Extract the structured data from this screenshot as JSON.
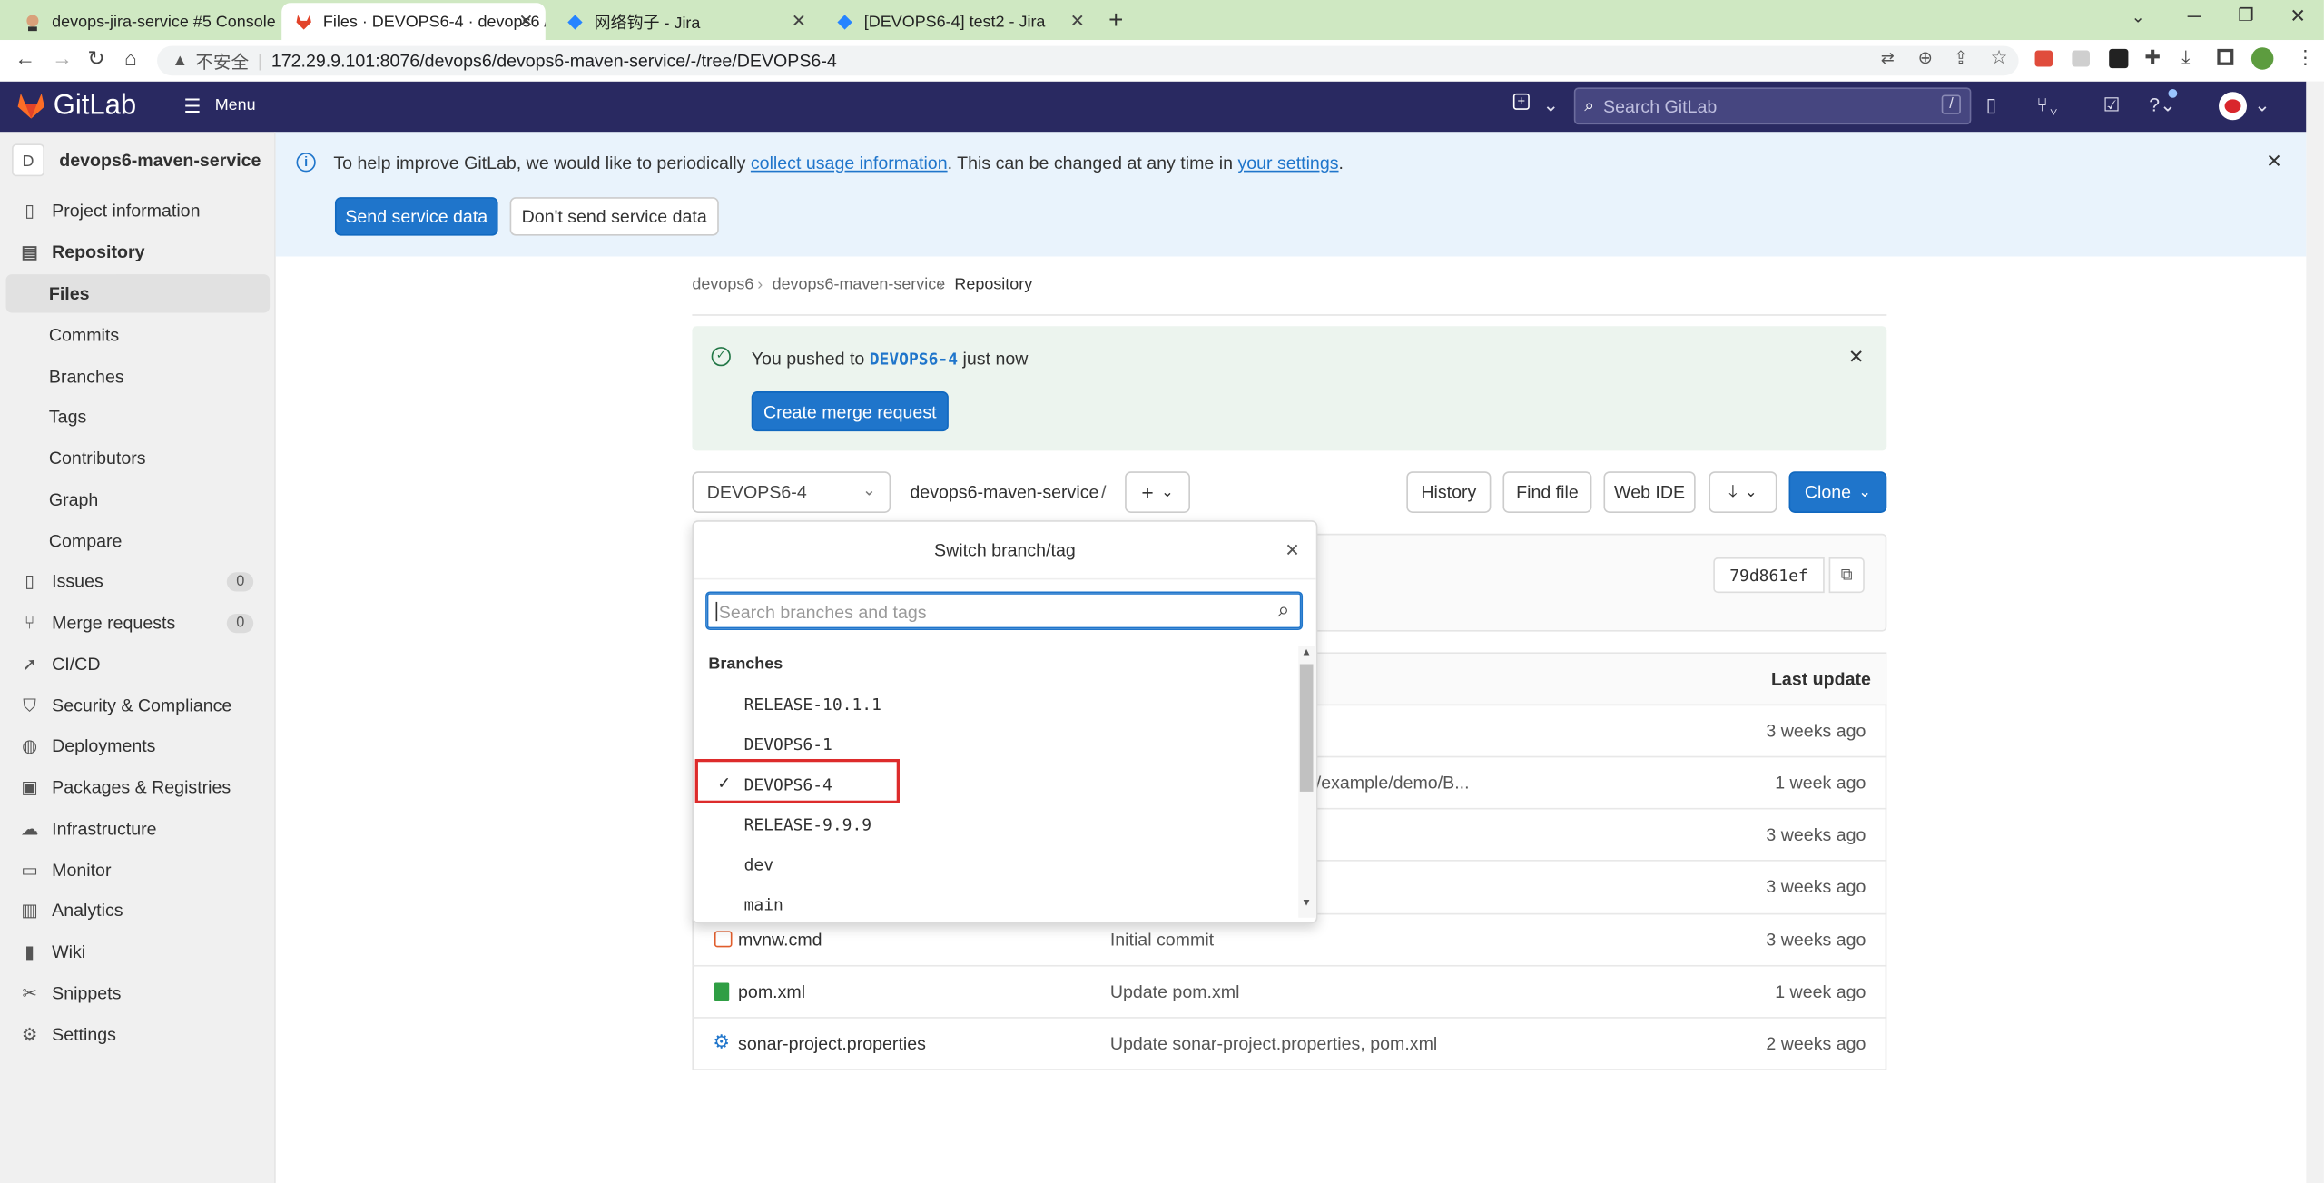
{
  "browser": {
    "tabs": [
      {
        "title": "devops-jira-service #5 Console"
      },
      {
        "title": "Files · DEVOPS6-4 · devops6 /"
      },
      {
        "title": "网络钩子 - Jira"
      },
      {
        "title": "[DEVOPS6-4] test2 - Jira"
      }
    ],
    "security_label": "不安全",
    "url": "172.29.9.101:8076/devops6/devops6-maven-service/-/tree/DEVOPS6-4"
  },
  "header": {
    "brand": "GitLab",
    "menu_label": "Menu",
    "search_placeholder": "Search GitLab",
    "search_shortcut": "/"
  },
  "sidebar": {
    "project_initial": "D",
    "project_name": "devops6-maven-service",
    "items": [
      {
        "label": "Project information",
        "icon": "info-doc-icon"
      },
      {
        "label": "Repository",
        "icon": "repository-icon"
      },
      {
        "label": "Files"
      },
      {
        "label": "Commits"
      },
      {
        "label": "Branches"
      },
      {
        "label": "Tags"
      },
      {
        "label": "Contributors"
      },
      {
        "label": "Graph"
      },
      {
        "label": "Compare"
      },
      {
        "label": "Issues",
        "count": "0"
      },
      {
        "label": "Merge requests",
        "count": "0"
      },
      {
        "label": "CI/CD"
      },
      {
        "label": "Security & Compliance"
      },
      {
        "label": "Deployments"
      },
      {
        "label": "Packages & Registries"
      },
      {
        "label": "Infrastructure"
      },
      {
        "label": "Monitor"
      },
      {
        "label": "Analytics"
      },
      {
        "label": "Wiki"
      },
      {
        "label": "Snippets"
      },
      {
        "label": "Settings"
      }
    ]
  },
  "banner": {
    "text_1": "To help improve GitLab, we would like to periodically",
    "link_1": "collect usage information",
    "text_2": ". This can be changed at any time in",
    "link_2": "your settings",
    "text_3": ".",
    "send_button": "Send service data",
    "dont_send_button": "Don't send service data"
  },
  "breadcrumb": [
    "devops6",
    "devops6-maven-service",
    "Repository"
  ],
  "push_alert": {
    "text_before": "You pushed to",
    "branch": "DEVOPS6-4",
    "text_after": "just now",
    "button": "Create merge request"
  },
  "repo_toolbar": {
    "branch_selector": "DEVOPS6-4",
    "path": "devops6-maven-service",
    "path_sep": "/",
    "history": "History",
    "find_file": "Find file",
    "web_ide": "Web IDE",
    "clone": "Clone"
  },
  "commit": {
    "sha": "79d861ef"
  },
  "file_table": {
    "last_update_header": "Last update",
    "rows": [
      {
        "name": "",
        "message": "",
        "date": "3 weeks ago"
      },
      {
        "name": "",
        "message": "/example/demo/B...",
        "date": "1 week ago"
      },
      {
        "name": "",
        "message": "",
        "date": "3 weeks ago"
      },
      {
        "name": "",
        "message": "",
        "date": "3 weeks ago"
      },
      {
        "name": "mvnw.cmd",
        "message": "Initial commit",
        "date": "3 weeks ago"
      },
      {
        "name": "pom.xml",
        "message": "Update pom.xml",
        "date": "1 week ago"
      },
      {
        "name": "sonar-project.properties",
        "message": "Update sonar-project.properties, pom.xml",
        "date": "2 weeks ago"
      }
    ]
  },
  "branch_dropdown": {
    "title": "Switch branch/tag",
    "search_placeholder": "Search branches and tags",
    "section_label": "Branches",
    "branches": [
      "RELEASE-10.1.1",
      "DEVOPS6-1",
      "DEVOPS6-4",
      "RELEASE-9.9.9",
      "dev",
      "main"
    ],
    "selected": "DEVOPS6-4"
  },
  "colors": {
    "header": "#292961",
    "accent": "#1f75cb",
    "tab_bar": "#cfe8c2",
    "highlight_box": "#dd2b2b"
  }
}
